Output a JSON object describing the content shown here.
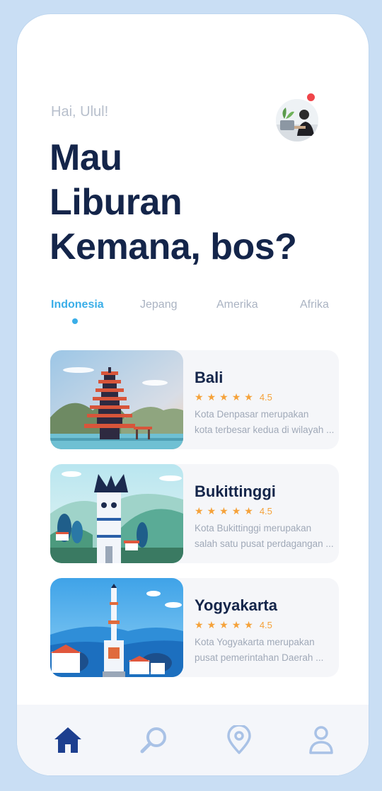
{
  "greeting": "Hai, Ulul!",
  "headline": [
    "Mau",
    "Liburan",
    "Kemana, bos?"
  ],
  "tabs": [
    {
      "label": "Indonesia",
      "active": true
    },
    {
      "label": "Jepang",
      "active": false
    },
    {
      "label": "Amerika",
      "active": false
    },
    {
      "label": "Afrika",
      "active": false
    }
  ],
  "destinations": [
    {
      "name": "Bali",
      "stars": 5,
      "rating": "4.5",
      "desc_lines": [
        "Kota Denpasar merupakan",
        "kota terbesar kedua di wilayah ..."
      ]
    },
    {
      "name": "Bukittinggi",
      "stars": 5,
      "rating": "4.5",
      "desc_lines": [
        "Kota Bukittinggi merupakan",
        "salah satu pusat perdagangan ..."
      ]
    },
    {
      "name": "Yogyakarta",
      "stars": 5,
      "rating": "4.5",
      "desc_lines": [
        "Kota Yogyakarta merupakan",
        "pusat pemerintahan Daerah ..."
      ]
    }
  ],
  "nav": [
    {
      "icon": "home-icon",
      "active": true
    },
    {
      "icon": "search-icon",
      "active": false
    },
    {
      "icon": "location-pin-icon",
      "active": false
    },
    {
      "icon": "user-icon",
      "active": false
    }
  ],
  "colors": {
    "background": "#c9def4",
    "headline": "#14254a",
    "accent": "#3aaee8",
    "star": "#f5a23a",
    "nav_active": "#1d3f8f",
    "nav_inactive": "#a9c2e6",
    "notification": "#f0454a"
  }
}
